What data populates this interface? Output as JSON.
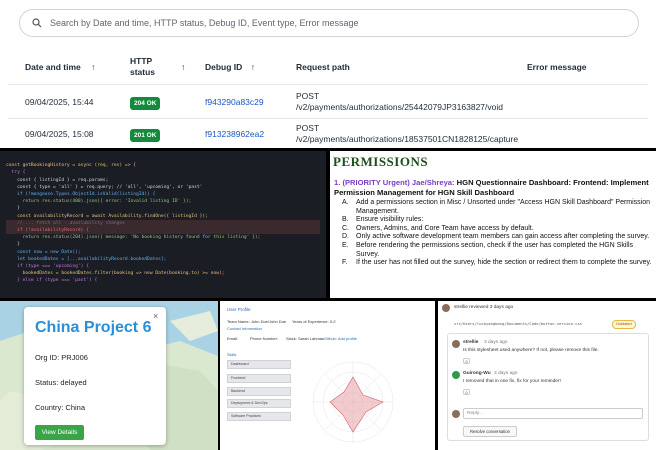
{
  "audit": {
    "search_placeholder": "Search by Date and time, HTTP status, Debug ID, Event type, Error message",
    "columns": [
      {
        "line1": "Date and time",
        "line2": ""
      },
      {
        "line1": "HTTP",
        "line2": "status"
      },
      {
        "line1": "Debug ID",
        "line2": ""
      },
      {
        "line1": "Request path",
        "line2": ""
      },
      {
        "line1": "Error message",
        "line2": ""
      }
    ],
    "rows": [
      {
        "date": "09/04/2025, 15:44",
        "status": "204 OK",
        "debug_id": "f943290a83c29",
        "method": "POST",
        "path": "/v2/payments/authorizations/25442079JP3163827/void"
      },
      {
        "date": "09/04/2025, 15:08",
        "status": "201 OK",
        "debug_id": "f913238962ea2",
        "method": "POST",
        "path": "/v2/payments/authorizations/18537501CN1828125/capture"
      }
    ]
  },
  "code": {
    "lines": [
      "const getBookingHistory = async (req, res) => {",
      "  try {",
      "    const { listingId } = req.params;",
      "    const { type = 'all' } = req.query; // 'all', 'upcoming', or 'past'",
      "",
      "    if (!mongoose.Types.ObjectId.isValid(listingId)) {",
      "      return res.status(400).json({ error: 'Invalid listing ID' });",
      "    }",
      "",
      "    const availabilityRecord = await Availability.findOne({ listingId });",
      "    // ... fetch all - availability changes",
      "    if (!availabilityRecord) {",
      "      return res.status(204).json({ message: 'No booking history found for this listing' });",
      "    }",
      "",
      "    const now = new Date();",
      "    let bookedDates = [...availabilityRecord.bookedDates];",
      "",
      "    if (type === 'upcoming') {",
      "      bookedDates = bookedDates.filter(booking => new Date(booking.to) >= now);",
      "    } else if (type === 'past') {"
    ]
  },
  "doc": {
    "title": "PERMISSIONS",
    "heading_prefix": "1. (PRIORITY Urgent) Jae/Shreya:",
    "heading_rest": " HGN Questionnaire Dashboard: Frontend: Implement Permission Management for HGN Skill Dashboard",
    "items": [
      {
        "letter": "A.",
        "text": "Add a permissions section in Misc / Unsorted under \"Access HGN Skill Dashboard\" Permission Management."
      },
      {
        "letter": "B.",
        "text": "Ensure visibility rules:"
      },
      {
        "letter": "C.",
        "text": "Owners, Admins, and Core Team have access by default."
      },
      {
        "letter": "D.",
        "text": "Only active software development team members can gain access after completing the survey."
      },
      {
        "letter": "E.",
        "text": "Before rendering the permissions section, check if the user has completed the HGN Skills Survey."
      },
      {
        "letter": "F.",
        "text": "If the user has not filled out the survey, hide the section or redirect them to complete the survey."
      }
    ]
  },
  "map_card": {
    "title": "China Project 6",
    "close": "×",
    "org": "Org ID: PRJ006",
    "status": "Status: delayed",
    "country": "Country: China",
    "button": "View Details"
  },
  "profile": {
    "header": "User Profile",
    "team_name": "Team Name: John Doe/John Doe",
    "experience": "Years of Experience: 0-2",
    "contact": "Contact Information",
    "email": "Email:",
    "phone": "Phone Number:",
    "slack": "Slack: Sarah Lahman",
    "github": "Github: Add profile",
    "skills_title": "Skills",
    "skills": [
      "Dashboard",
      "Frontend",
      "Backend",
      "Deployment & DevOps",
      "Software Practices"
    ]
  },
  "comments": {
    "header": "strellie reviewed 3 days ago",
    "file": "src/Users/luckyangbang/Documents/Code/button-version.css",
    "outdated": "Outdated",
    "c1_user": "strellie",
    "c1_time": "3 days ago",
    "c1_text": "Is this stylesheet used anywhere? If not, please remove this file.",
    "c2_user": "Guirong-Wu",
    "c2_time": "3 days ago",
    "c2_text": "I removed that in one fix, fix for your reminder!",
    "reply": "Reply...",
    "resolve": "Resolve conversation"
  }
}
